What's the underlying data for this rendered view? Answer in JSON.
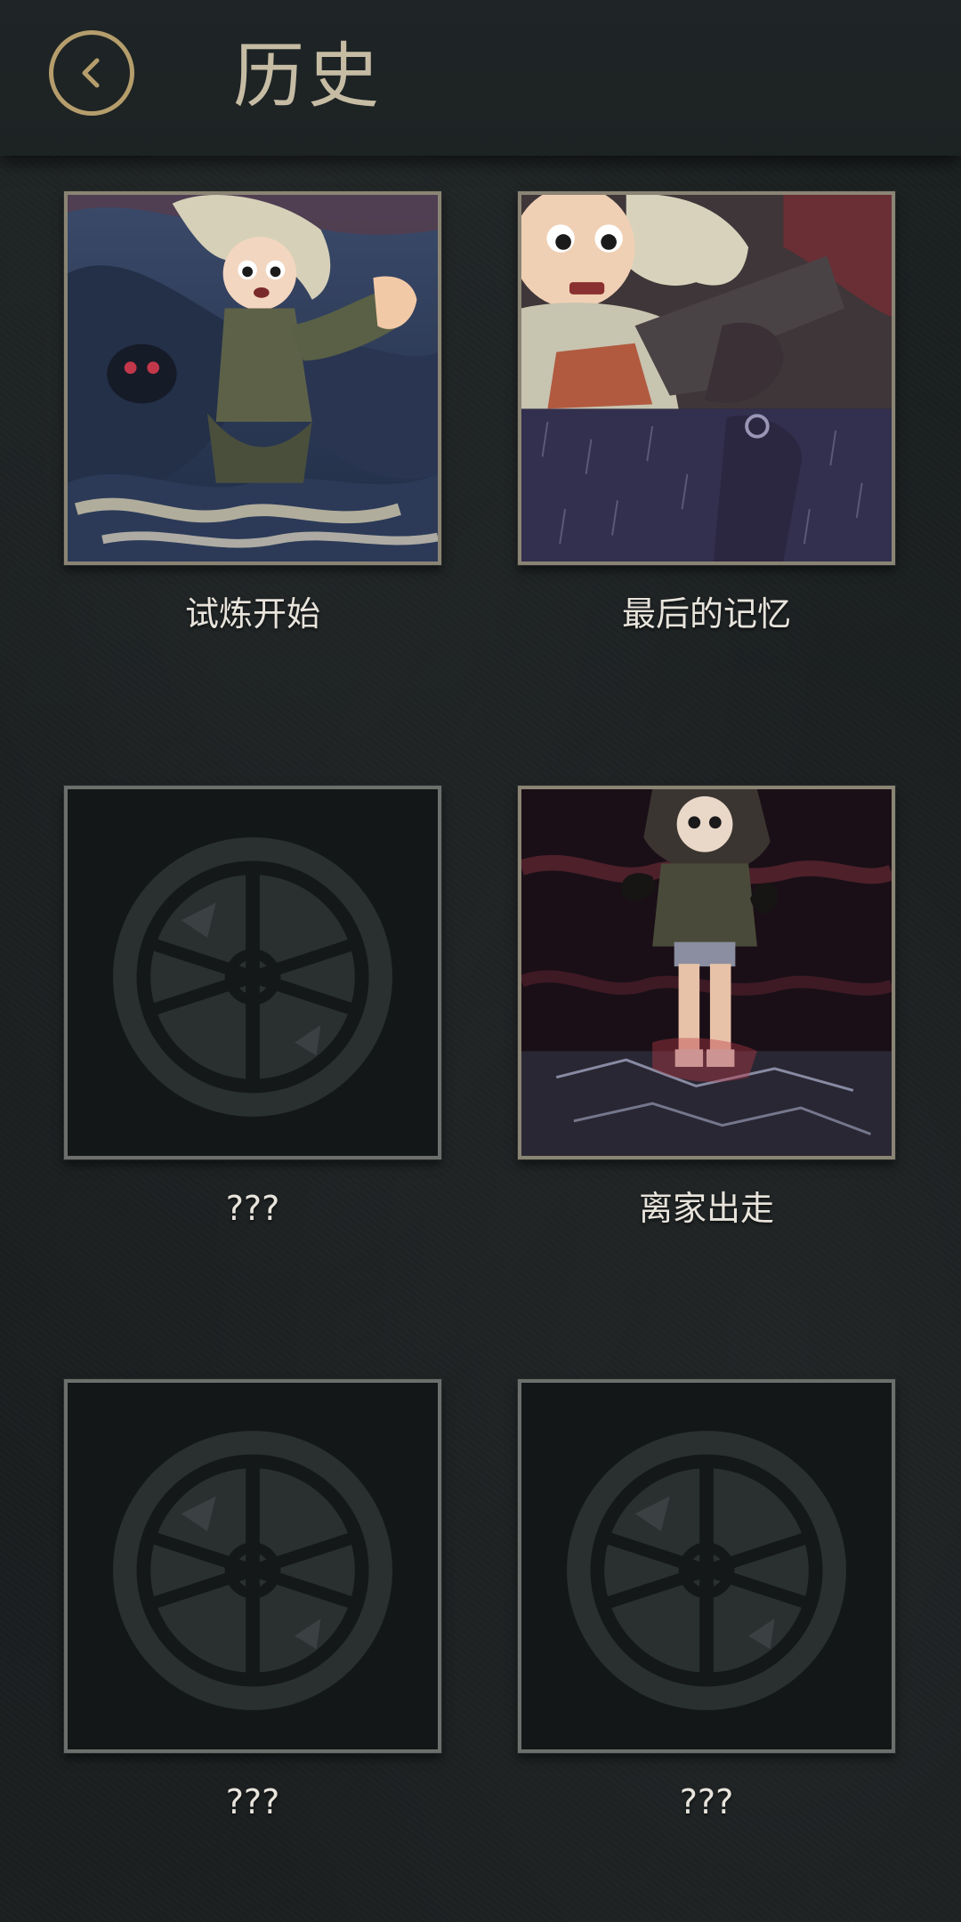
{
  "header": {
    "title": "历史",
    "back_icon": "chevron-left-icon"
  },
  "colors": {
    "accent_gold": "#b59e6c",
    "title_text": "#c6bca4",
    "caption_text": "#e8e4dc",
    "background": "#1b1f20"
  },
  "entries": [
    {
      "caption": "试炼开始",
      "locked": false
    },
    {
      "caption": "最后的记忆",
      "locked": false
    },
    {
      "caption": "???",
      "locked": true,
      "icon": "sealed-emblem-icon"
    },
    {
      "caption": "离家出走",
      "locked": false
    },
    {
      "caption": "???",
      "locked": true,
      "icon": "sealed-emblem-icon"
    },
    {
      "caption": "???",
      "locked": true,
      "icon": "sealed-emblem-icon"
    }
  ]
}
